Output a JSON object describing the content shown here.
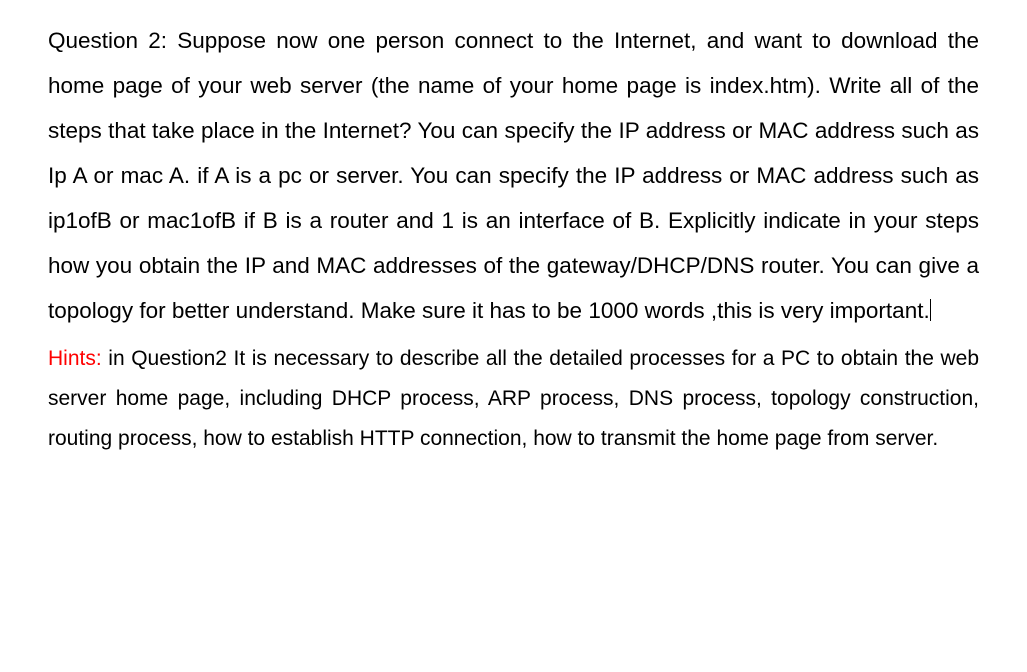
{
  "question": {
    "text": "Question 2: Suppose now one person connect to the Internet, and want to download the home page of your web server (the name of your home page is index.htm). Write all of the steps that take place in the Internet? You can specify the IP address or MAC address such as Ip A or mac A. if A is a pc or server. You can specify the IP address or MAC address such as ip1ofB or mac1ofB if B is a router and 1 is an interface of B. Explicitly indicate in your steps how you obtain the IP and MAC addresses of the gateway/DHCP/DNS router. You can give a topology for better understand. Make sure it has to be 1000 words ,this is very important."
  },
  "hints": {
    "label": "Hints:",
    "text": " in Question2 It is necessary to describe all the detailed processes for a PC to obtain the web server home page, including DHCP process, ARP process, DNS process, topology construction, routing process, how to establish HTTP connection, how to transmit the home page from server."
  }
}
